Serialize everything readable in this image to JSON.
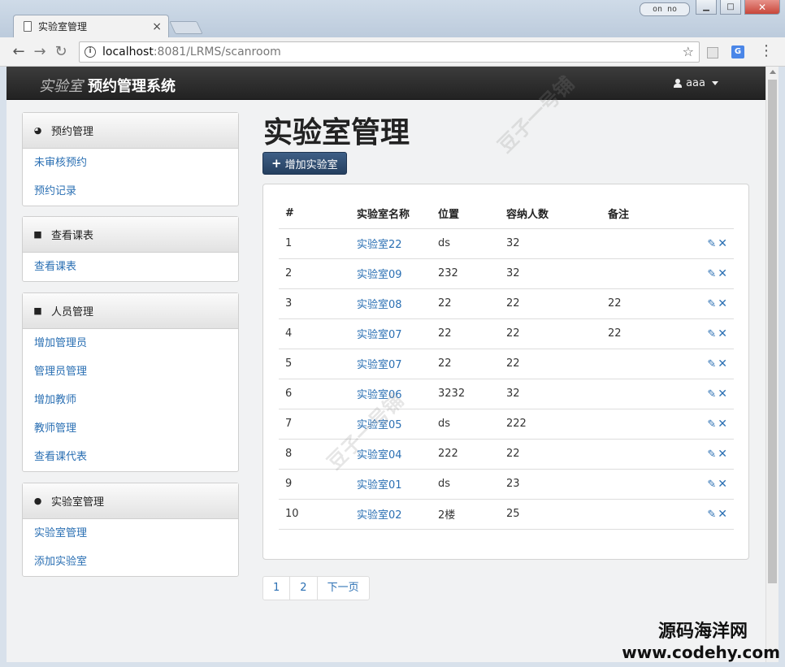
{
  "browser": {
    "tab_title": "实验室管理",
    "tab_close": "×",
    "window_note": "on no",
    "url_host": "localhost",
    "url_rest": ":8081/LRMS/scanroom",
    "star": "☆",
    "menu": "⋮",
    "ext_label": "G"
  },
  "navbar": {
    "brand_light": "实验室",
    "brand_bold": "预约管理系统",
    "user": "aaa"
  },
  "sidebar": [
    {
      "title": "预约管理",
      "icon": "dashboard-icon",
      "items": [
        "未审核预约",
        "预约记录"
      ]
    },
    {
      "title": "查看课表",
      "icon": "briefcase-icon",
      "items": [
        "查看课表"
      ]
    },
    {
      "title": "人员管理",
      "icon": "briefcase-icon",
      "items": [
        "增加管理员",
        "管理员管理",
        "增加教师",
        "教师管理",
        "查看课代表"
      ]
    },
    {
      "title": "实验室管理",
      "icon": "exclamation-icon",
      "items": [
        "实验室管理",
        "添加实验室"
      ]
    }
  ],
  "main": {
    "title": "实验室管理",
    "add_button": "增加实验室"
  },
  "table": {
    "headers": [
      "#",
      "实验室名称",
      "位置",
      "容纳人数",
      "备注",
      ""
    ],
    "rows": [
      [
        "1",
        "实验室22",
        "ds",
        "32",
        ""
      ],
      [
        "2",
        "实验室09",
        "232",
        "32",
        ""
      ],
      [
        "3",
        "实验室08",
        "22",
        "22",
        "22"
      ],
      [
        "4",
        "实验室07",
        "22",
        "22",
        "22"
      ],
      [
        "5",
        "实验室07",
        "22",
        "22",
        ""
      ],
      [
        "6",
        "实验室06",
        "3232",
        "32",
        ""
      ],
      [
        "7",
        "实验室05",
        "ds",
        "222",
        ""
      ],
      [
        "8",
        "实验室04",
        "222",
        "22",
        ""
      ],
      [
        "9",
        "实验室01",
        "ds",
        "23",
        ""
      ],
      [
        "10",
        "实验室02",
        "2楼",
        "25",
        ""
      ]
    ]
  },
  "pagination": [
    "1",
    "2",
    "下一页"
  ],
  "watermark": "豆子一号铺",
  "corner": {
    "cn": "源码海洋网",
    "en": "www.codehy.com"
  },
  "colors": {
    "link": "#2a6fb3",
    "navbar": "#2a2a2a",
    "button": "#2f4d72"
  }
}
